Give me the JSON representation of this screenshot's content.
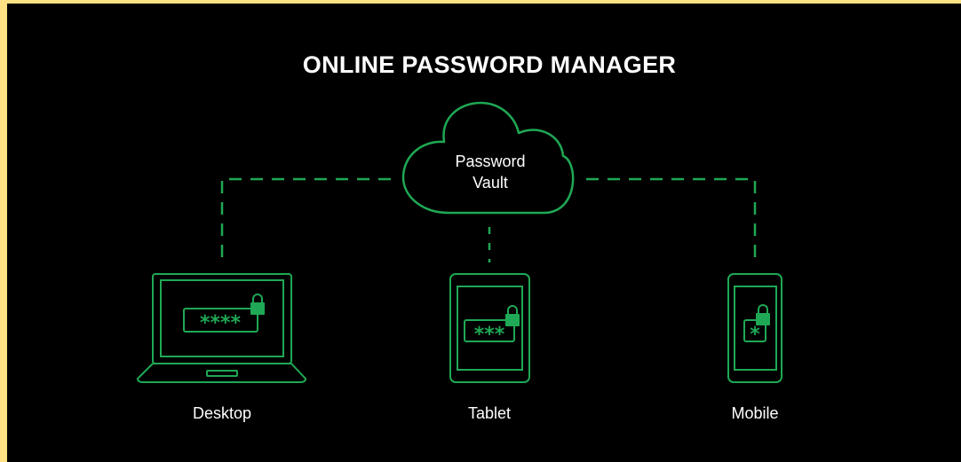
{
  "title": "ONLINE PASSWORD MANAGER",
  "vault": {
    "line1": "Password",
    "line2": "Vault"
  },
  "devices": [
    {
      "label": "Desktop",
      "password_mask": "****"
    },
    {
      "label": "Tablet",
      "password_mask": "***"
    },
    {
      "label": "Mobile",
      "password_mask": "*"
    }
  ],
  "colors": {
    "background": "#000000",
    "border": "#ffe082",
    "accent": "#1fa855",
    "text": "#ffffff"
  },
  "icons": [
    "cloud-icon",
    "laptop-icon",
    "tablet-icon",
    "phone-icon",
    "lock-icon"
  ]
}
